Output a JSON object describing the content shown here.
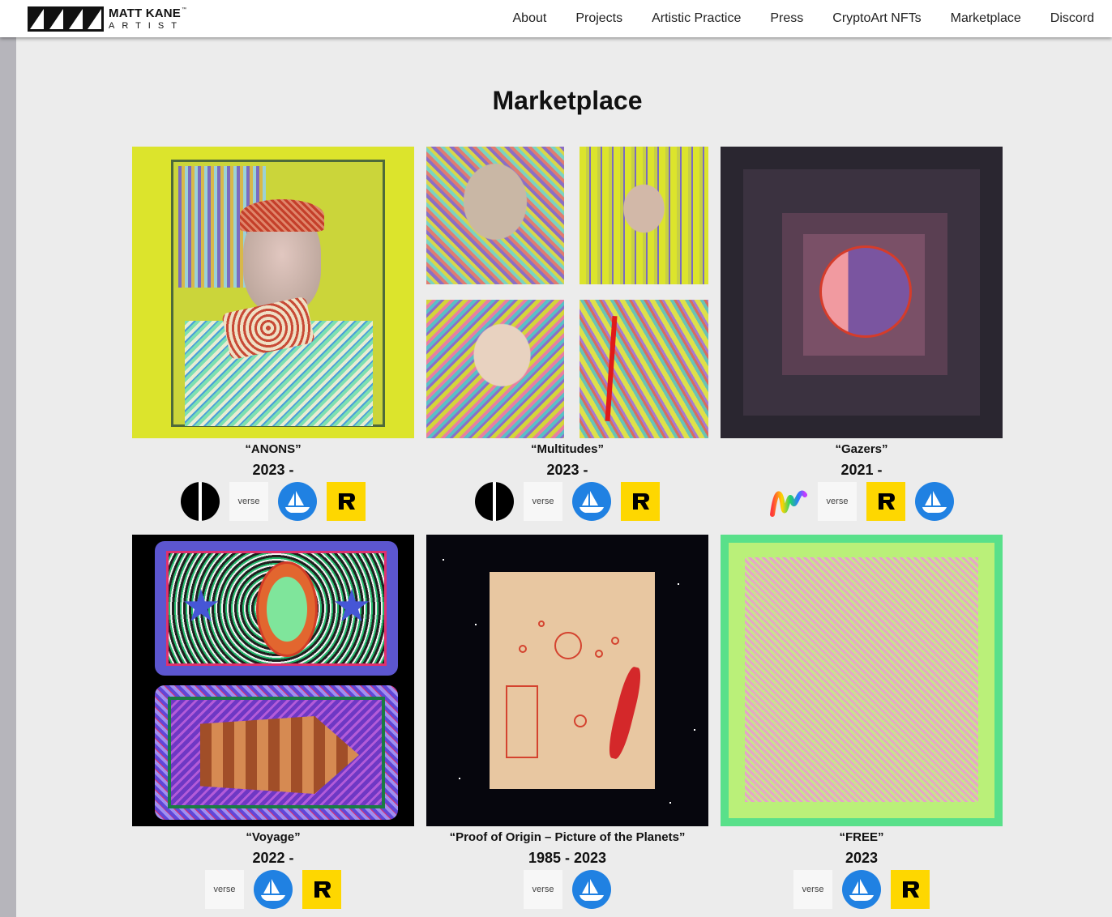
{
  "logo": {
    "name": "MATT KANE",
    "tagline": "ARTIST",
    "tm": "™"
  },
  "nav": [
    "About",
    "Projects",
    "Artistic Practice",
    "Press",
    "CryptoArt NFTs",
    "Marketplace",
    "Discord"
  ],
  "page": {
    "title": "Marketplace"
  },
  "cards": [
    {
      "title": "“ANONS”",
      "years": "2023 -",
      "icons": [
        "foundation-icon",
        "verse-icon",
        "opensea-icon",
        "rarible-icon"
      ]
    },
    {
      "title": "“Multitudes”",
      "years": "2023 -",
      "icons": [
        "foundation-icon",
        "verse-icon",
        "opensea-icon",
        "rarible-icon"
      ]
    },
    {
      "title": "“Gazers”",
      "years": "2021 -",
      "icons": [
        "async-art-icon",
        "verse-icon",
        "rarible-icon",
        "opensea-icon"
      ]
    },
    {
      "title": "“Voyage”",
      "years": "2022 -",
      "icons": [
        "verse-icon",
        "opensea-icon",
        "rarible-icon"
      ]
    },
    {
      "title": "“Proof of Origin – Picture of the Planets”",
      "years": "1985 - 2023",
      "icons": [
        "verse-icon",
        "opensea-icon"
      ]
    },
    {
      "title": "“FREE”",
      "years": "2023",
      "icons": [
        "verse-icon",
        "opensea-icon",
        "rarible-icon"
      ]
    }
  ],
  "labels": {
    "verse": "verse"
  },
  "colors": {
    "rarible": "#fed700",
    "opensea": "#2081e2",
    "background": "#ececec"
  }
}
